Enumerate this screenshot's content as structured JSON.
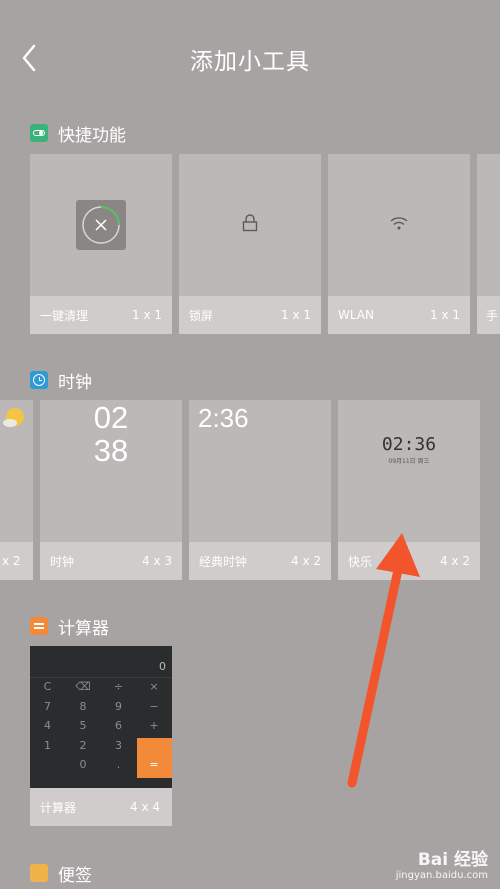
{
  "header": {
    "title": "添加小工具"
  },
  "sections": {
    "quick": {
      "title": "快捷功能",
      "cards": [
        {
          "name": "一键清理",
          "size": "1 x 1"
        },
        {
          "name": "锁屏",
          "size": "1 x 1"
        },
        {
          "name": "WLAN",
          "size": "1 x 1"
        },
        {
          "name": "手"
        }
      ]
    },
    "clock": {
      "title": "时钟",
      "cards": [
        {
          "size": "x 2"
        },
        {
          "name": "时钟",
          "size": "4 x 3",
          "hour": "02",
          "minute": "38"
        },
        {
          "name": "经典时钟",
          "size": "4 x 2",
          "time": "2:36"
        },
        {
          "name": "快乐",
          "name_tail": "ち",
          "size": "4 x 2",
          "time": "02:36",
          "date": "09月11日 周三"
        }
      ]
    },
    "calculator": {
      "title": "计算器",
      "card": {
        "name": "计算器",
        "size": "4 x 4",
        "display": "0",
        "keys": [
          "C",
          "⌫",
          "÷",
          "×",
          "7",
          "8",
          "9",
          "−",
          "4",
          "5",
          "6",
          "+",
          "1",
          "2",
          "3",
          "",
          "",
          "0",
          ".",
          "="
        ]
      }
    },
    "notes": {
      "title": "便签"
    }
  },
  "watermark": {
    "brand": "Bai 经验",
    "url": "jingyan.baidu.com"
  },
  "colors": {
    "arrow": "#f2552c",
    "calc_accent": "#f28a3a",
    "quick_icon": "#3bb27a",
    "clock_icon": "#2e9ad6",
    "calc_icon": "#f28a3a",
    "notes_icon": "#f0b34a"
  }
}
